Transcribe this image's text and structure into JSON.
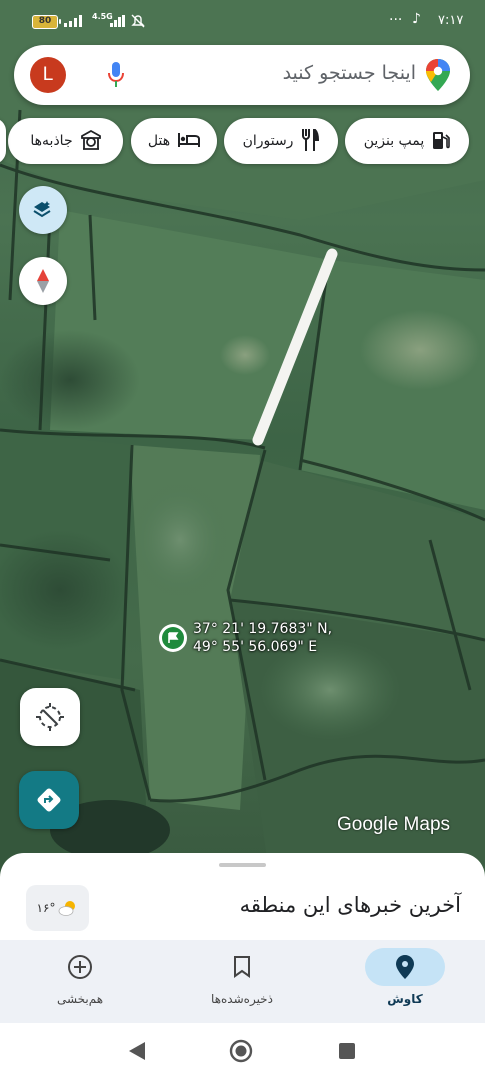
{
  "status_bar": {
    "battery": "80",
    "network": "4.5G",
    "time": "۷:۱۷"
  },
  "search": {
    "avatar_letter": "L",
    "placeholder": "اینجا جستجو کنید"
  },
  "chips": [
    {
      "label": "پمپ بنزین",
      "icon": "gas-station-icon"
    },
    {
      "label": "رستوران",
      "icon": "fork-knife-icon"
    },
    {
      "label": "هتل",
      "icon": "bed-icon"
    },
    {
      "label": "جاذبه‌ها",
      "icon": "attraction-icon"
    }
  ],
  "pin": {
    "lat": "37° 21' 19.7683\" N,",
    "lon": "49° 55' 56.069\" E"
  },
  "watermark": "Google Maps",
  "sheet": {
    "title": "آخرین خبرهای این منطقه",
    "weather_temp": "۱۶°"
  },
  "nav": {
    "explore": "کاوش",
    "saved": "ذخیره‌شده‌ها",
    "contribute": "هم‌بخشی"
  },
  "colors": {
    "accent": "#137a85",
    "avatar": "#c83a1e",
    "nav_active": "#c5e3f6"
  }
}
